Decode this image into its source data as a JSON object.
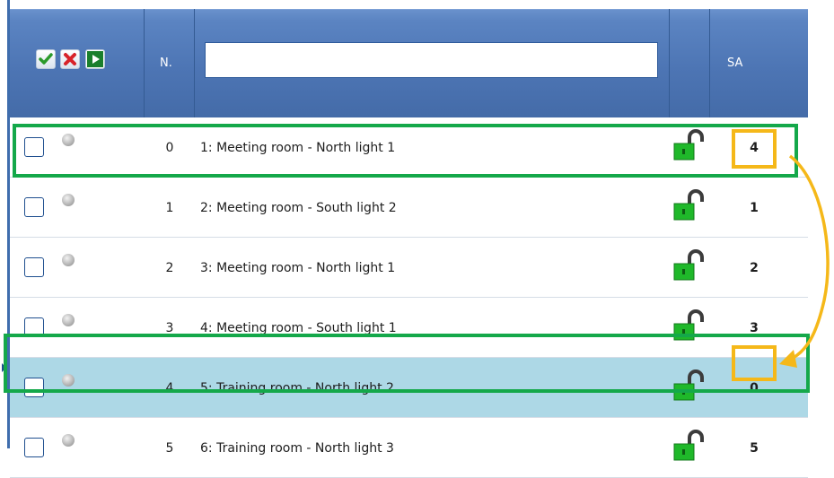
{
  "header": {
    "number_label": "N.",
    "sa_label": "SA",
    "search_value": "",
    "search_placeholder": ""
  },
  "rows": [
    {
      "number": "0",
      "name": "1: Meeting room - North light 1",
      "sa": "4"
    },
    {
      "number": "1",
      "name": "2: Meeting room - South light  2",
      "sa": "1"
    },
    {
      "number": "2",
      "name": "3: Meeting room - North light  1",
      "sa": "2"
    },
    {
      "number": "3",
      "name": "4: Meeting room - South light 1",
      "sa": "3"
    },
    {
      "number": "4",
      "name": "5: Training room - North light 2",
      "sa": "0"
    },
    {
      "number": "5",
      "name": "6: Training room - North light 3",
      "sa": "5"
    }
  ],
  "selected_row_index": 4,
  "icons": {
    "select_all": "check-icon",
    "deselect_all": "red-x-icon",
    "apply": "play-icon",
    "row_status": "gray-dot-icon",
    "row_lock": "green-open-padlock-icon"
  },
  "colors": {
    "header": "#4d75b4",
    "selected_row": "#add8e6",
    "highlight_green": "#14a84a",
    "highlight_orange": "#f5b819"
  }
}
